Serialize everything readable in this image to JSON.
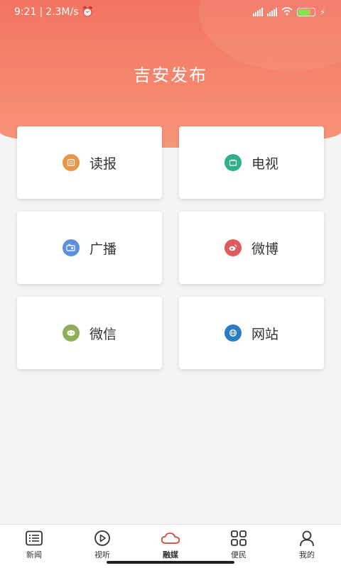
{
  "status": {
    "time": "9:21",
    "speed": "2.3M/s"
  },
  "header": {
    "title": "吉安发布"
  },
  "cards": [
    {
      "label": "读报",
      "icon": "newspaper-icon",
      "color": "#e8964a"
    },
    {
      "label": "电视",
      "icon": "tv-icon",
      "color": "#2fb08a"
    },
    {
      "label": "广播",
      "icon": "radio-icon",
      "color": "#5b8fe0"
    },
    {
      "label": "微博",
      "icon": "weibo-icon",
      "color": "#e05b5b"
    },
    {
      "label": "微信",
      "icon": "wechat-icon",
      "color": "#8fae5a"
    },
    {
      "label": "网站",
      "icon": "website-icon",
      "color": "#2a7fc4"
    }
  ],
  "tabs": [
    {
      "label": "新闻",
      "icon": "list-icon",
      "active": false
    },
    {
      "label": "视听",
      "icon": "play-icon",
      "active": false
    },
    {
      "label": "融媒",
      "icon": "cloud-icon",
      "active": true
    },
    {
      "label": "便民",
      "icon": "grid-icon",
      "active": false
    },
    {
      "label": "我的",
      "icon": "user-icon",
      "active": false
    }
  ],
  "colors": {
    "brand": "#f27561",
    "active_tab": "#d9453a"
  }
}
